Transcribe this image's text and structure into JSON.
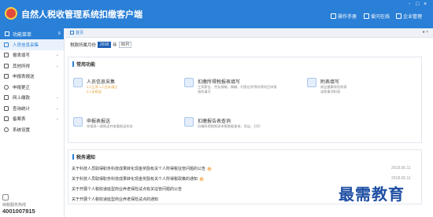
{
  "header": {
    "title": "自然人税收管理系统扣缴客户端",
    "buttons": [
      {
        "label": "操作手册",
        "icon": "manual-icon"
      },
      {
        "label": "爱问在线",
        "icon": "chat-icon"
      },
      {
        "label": "企业管理",
        "icon": "enterprise-icon"
      }
    ],
    "window_controls": [
      "-",
      "□",
      "×"
    ]
  },
  "sidebar": {
    "header_label": "功能菜单",
    "items": [
      {
        "label": "人员信息采集",
        "active": true,
        "arrow": false
      },
      {
        "label": "报表填写",
        "active": false,
        "arrow": true
      },
      {
        "label": "其他所得",
        "active": false,
        "arrow": true
      },
      {
        "label": "申报表报送",
        "active": false,
        "arrow": false
      },
      {
        "label": "申报更正",
        "active": false,
        "arrow": false
      },
      {
        "label": "网上缴款",
        "active": false,
        "arrow": true
      },
      {
        "label": "查询统计",
        "active": false,
        "arrow": true
      },
      {
        "label": "备案表",
        "active": false,
        "arrow": true
      },
      {
        "label": "系统设置",
        "active": false,
        "arrow": false
      }
    ],
    "phone_label": "纳税服务热线",
    "phone_number": "4001007815"
  },
  "tabbar": {
    "tab_label": "首页",
    "controls": "● ×"
  },
  "period": {
    "label": "税款所属月份",
    "year": "2018",
    "month_suffix": "年",
    "month": "06月"
  },
  "common_functions": {
    "title": "常用功能",
    "items": [
      {
        "title": "人员信息采集",
        "desc": [
          "1人正常  1人还未通过",
          "2人未报送"
        ],
        "warn": true
      },
      {
        "title": "扣缴所得税报表填写",
        "desc": [
          "工资薪金、劳务报酬、稿酬、利息红利等所得项目申报",
          "表的填写"
        ],
        "warn": false
      },
      {
        "title": "附表填写",
        "desc": [
          "商业健康保险附表",
          "减免事项附表"
        ],
        "warn": false
      },
      {
        "title": "申报表报送",
        "desc": [
          "申报表一键报送并查看报送状态"
        ],
        "warn": false
      },
      {
        "title": "扣缴报告表查询",
        "desc": [
          "扣缴所得税报表申报数据查询、导出、打印"
        ],
        "warn": false
      }
    ]
  },
  "notices": {
    "title": "税务通知",
    "items": [
      {
        "text": "关于科技人员取得职务科技成果转化现金奖励有关个人所得税征管问题的公告",
        "badge": "新",
        "date": "2018.06.11"
      },
      {
        "text": "关于科技人员取得职务科技成果转化现金奖励有关个人所得税政策的通知",
        "badge": "新",
        "date": "2018.06.11"
      },
      {
        "text": "关于开展个人税收递延型商业养老保险试点有关征管问题的公告",
        "badge": "",
        "date": ""
      },
      {
        "text": "关于开展个人税收递延型商业养老保险试点的通知",
        "badge": "",
        "date": ""
      }
    ]
  },
  "watermark": "最需教育",
  "colors": {
    "brand_blue": "#2a7fd6",
    "sidebar_active_bg": "#e9f2fc",
    "warn_orange": "#e8a23a",
    "logo_red": "#e24b3b"
  }
}
